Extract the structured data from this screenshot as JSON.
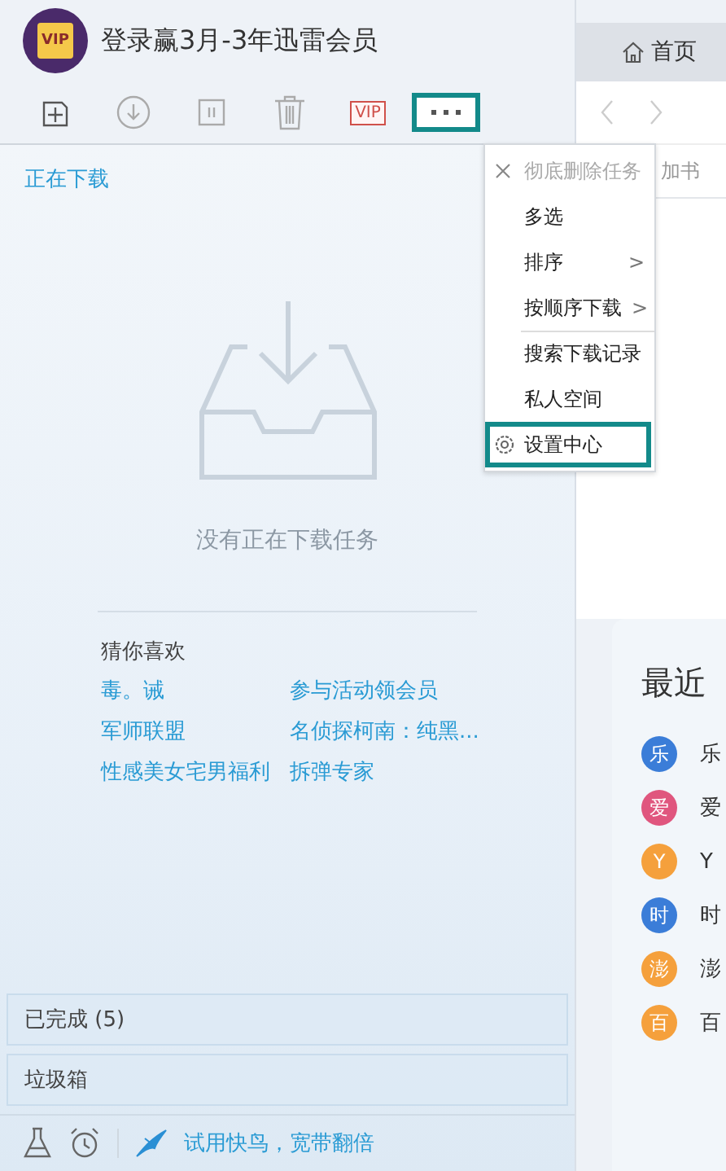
{
  "header": {
    "title": "登录赢3月-3年迅雷会员",
    "avatar_label": "VIP"
  },
  "toolbar": [
    {
      "kind": "new",
      "selected": false
    },
    {
      "kind": "download",
      "selected": false
    },
    {
      "kind": "pause",
      "selected": false
    },
    {
      "kind": "delete",
      "selected": false
    },
    {
      "kind": "vip",
      "label": "VIP",
      "selected": false
    },
    {
      "kind": "more",
      "selected": true
    }
  ],
  "menu": [
    {
      "kind": "delete",
      "label": "彻底删除任务",
      "disabled": true,
      "highlighted": false,
      "separator_before": false
    },
    {
      "kind": "plain",
      "label": "多选",
      "disabled": false,
      "highlighted": false,
      "separator_before": false
    },
    {
      "kind": "submenu",
      "label": "排序",
      "arrow": ">",
      "disabled": false,
      "highlighted": false,
      "separator_before": false
    },
    {
      "kind": "submenu",
      "label": "按顺序下载",
      "arrow": ">",
      "disabled": false,
      "highlighted": false,
      "separator_before": false
    },
    {
      "kind": "plain",
      "label": "搜索下载记录",
      "disabled": false,
      "highlighted": false,
      "separator_before": true
    },
    {
      "kind": "plain",
      "label": "私人空间",
      "disabled": false,
      "highlighted": false,
      "separator_before": false
    },
    {
      "kind": "settings",
      "label": "设置中心",
      "disabled": false,
      "highlighted": true,
      "separator_before": false
    }
  ],
  "downloading": {
    "heading": "正在下载",
    "empty_text": "没有正在下载任务"
  },
  "suggestions": {
    "heading": "猜你喜欢",
    "links": [
      "毒。诫",
      "参与活动领会员",
      "军师联盟",
      "名侦探柯南：纯黑...",
      "性感美女宅男福利",
      "拆弹专家"
    ]
  },
  "categories": [
    {
      "label": "已完成 (5)"
    },
    {
      "label": "垃圾箱"
    }
  ],
  "footer": {
    "promo": "试用快鸟，宽带翻倍"
  },
  "browser": {
    "tab": "首页",
    "address": "加书",
    "recent": {
      "title": "最近",
      "items": [
        {
          "badge": "乐",
          "label": "乐",
          "color": "#3b7dd8"
        },
        {
          "badge": "爱",
          "label": "爱",
          "color": "#e0567e"
        },
        {
          "badge": "Y",
          "label": "Y",
          "color": "#f5a03c"
        },
        {
          "badge": "时",
          "label": "时",
          "color": "#3b7dd8"
        },
        {
          "badge": "澎",
          "label": "澎",
          "color": "#f5a03c"
        },
        {
          "badge": "百",
          "label": "百",
          "color": "#f5a03c"
        }
      ]
    }
  }
}
